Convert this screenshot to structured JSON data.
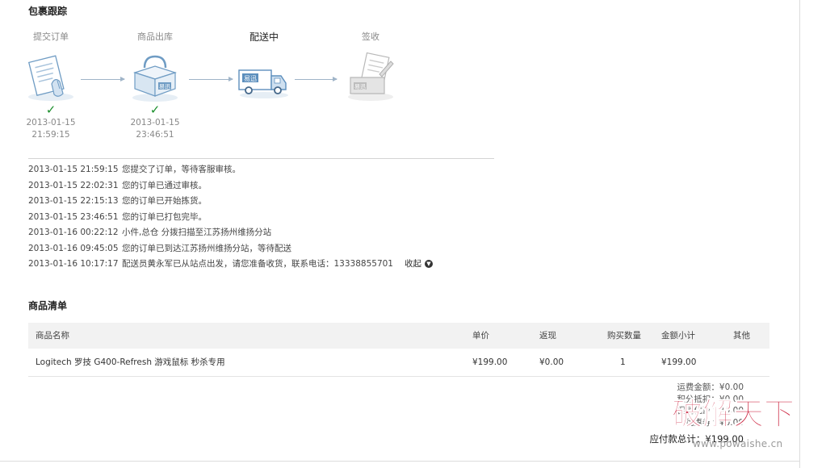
{
  "tracking": {
    "title": "包裹跟踪",
    "steps": [
      {
        "label": "提交订单",
        "date": "2013-01-15",
        "time": "21:59:15",
        "done": true
      },
      {
        "label": "商品出库",
        "date": "2013-01-15",
        "time": "23:46:51",
        "done": true
      },
      {
        "label": "配送中",
        "date": "",
        "time": "",
        "done": false,
        "active": true
      },
      {
        "label": "签收",
        "date": "",
        "time": "",
        "done": false
      }
    ],
    "check_glyph": "✓",
    "brand": "易迅",
    "log": [
      {
        "time": "2013-01-15 21:59:15",
        "text": "您提交了订单，等待客服审核。"
      },
      {
        "time": "2013-01-15 22:02:31",
        "text": "您的订单已通过审核。"
      },
      {
        "time": "2013-01-15 22:15:13",
        "text": "您的订单已开始拣货。"
      },
      {
        "time": "2013-01-15 23:46:51",
        "text": "您的订单已打包完毕。"
      },
      {
        "time": "2013-01-16 00:22:12",
        "text": "小件,总仓 分拨扫描至江苏扬州维扬分站"
      },
      {
        "time": "2013-01-16 09:45:05",
        "text": "您的订单已到达江苏扬州维扬分站，等待配送"
      },
      {
        "time": "2013-01-16 10:17:17",
        "text": "配送员黄永军已从站点出发，请您准备收货，联系电话：13338855701"
      }
    ],
    "collapse_label": "收起",
    "collapse_icon": "chevron-down-icon"
  },
  "goods": {
    "title": "商品清单",
    "columns": [
      "商品名称",
      "单价",
      "返现",
      "购买数量",
      "金额小计",
      "其他"
    ],
    "rows": [
      {
        "name": "Logitech 罗技 G400-Refresh 游戏鼠标 秒杀专用",
        "price": "¥199.00",
        "rebate": "¥0.00",
        "qty": "1",
        "subtotal": "¥199.00",
        "other": ""
      }
    ]
  },
  "summary": {
    "shipping": "运费金额：¥0.00",
    "points": "积分抵扣：¥0.00",
    "promo": "促销优惠：¥0.00",
    "coupon": "优惠券：¥0.00",
    "total": "应付款总计：¥199.00"
  },
  "watermark": {
    "text": "破解天下",
    "url": "www.powaishe.cn"
  },
  "colors": {
    "check": "#1a8f2b",
    "arrow": "#9fb4c8",
    "header_bg": "#f2f2f2",
    "watermark_red": "#c8102e"
  }
}
